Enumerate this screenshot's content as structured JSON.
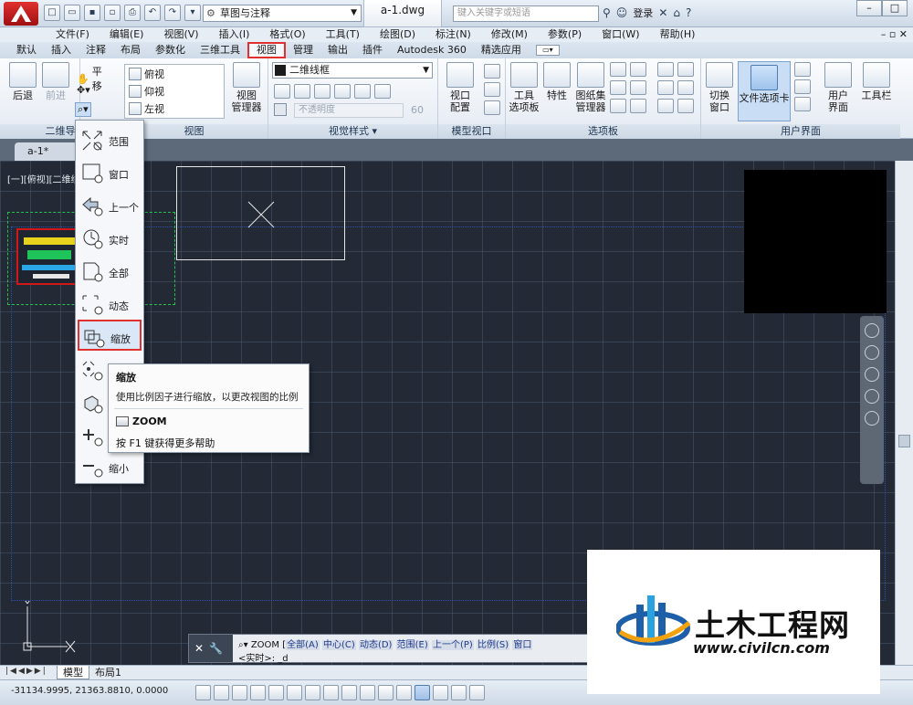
{
  "titlebar": {
    "workspace": "草图与注释",
    "doc_title": "a-1.dwg",
    "search_placeholder": "键入关键字或短语",
    "login": "登录"
  },
  "menubar": [
    "文件(F)",
    "编辑(E)",
    "视图(V)",
    "插入(I)",
    "格式(O)",
    "工具(T)",
    "绘图(D)",
    "标注(N)",
    "修改(M)",
    "参数(P)",
    "窗口(W)",
    "帮助(H)"
  ],
  "ribbon_tabs": [
    "默认",
    "插入",
    "注释",
    "布局",
    "参数化",
    "三维工具",
    "视图",
    "管理",
    "输出",
    "插件",
    "Autodesk 360",
    "精选应用"
  ],
  "active_tab": "视图",
  "ribbon": {
    "nav_panel": {
      "title": "二维导",
      "back": "后退",
      "forward": "前进",
      "pan": "平移"
    },
    "view_panel": {
      "title": "视图",
      "views": [
        "俯视",
        "仰视",
        "左视"
      ],
      "manager_l1": "视图",
      "manager_l2": "管理器"
    },
    "visual_panel": {
      "title": "视觉样式",
      "style": "二维线框",
      "opacity_label": "不透明度",
      "opacity_value": "60"
    },
    "model_viewport_panel": {
      "title": "模型视口",
      "config_l1": "视口",
      "config_l2": "配置"
    },
    "palettes_panel": {
      "title": "选项板",
      "tool_palette_l1": "工具",
      "tool_palette_l2": "选项板",
      "properties": "特性",
      "sheetset_l1": "图纸集",
      "sheetset_l2": "管理器"
    },
    "ui_panel": {
      "title": "用户界面",
      "switch_l1": "切换",
      "switch_l2": "窗口",
      "file_tabs": "文件选项卡",
      "ui_l1": "用户",
      "ui_l2": "界面",
      "toolbar": "工具栏"
    }
  },
  "doc_tab": "a-1*",
  "viewport_label": "[一][俯视][二维线",
  "zoom_menu": [
    "范围",
    "窗口",
    "上一个",
    "实时",
    "全部",
    "动态",
    "缩放",
    "",
    "",
    "",
    "缩小"
  ],
  "tooltip": {
    "title": "缩放",
    "desc": "使用比例因子进行缩放，以更改视图的比例",
    "command": "ZOOM",
    "help": "按 F1 键获得更多帮助"
  },
  "cmdline": {
    "prefix": "ZOOM [",
    "options": [
      "全部(A)",
      "中心(C)",
      "动态(D)",
      "范围(E)",
      "上一个(P)",
      "比例(S)",
      "窗口"
    ],
    "prompt": "<实时>: _d"
  },
  "layout_tabs": [
    "模型",
    "布局1"
  ],
  "status": {
    "coords": "-31134.9995, 21363.8810, 0.0000"
  },
  "watermark": {
    "title": "土木工程网",
    "url": "www.civilcn.com"
  },
  "colors": {
    "canvas_bg": "#232a36",
    "highlight": "#e03030",
    "selection": "#25c14f"
  }
}
